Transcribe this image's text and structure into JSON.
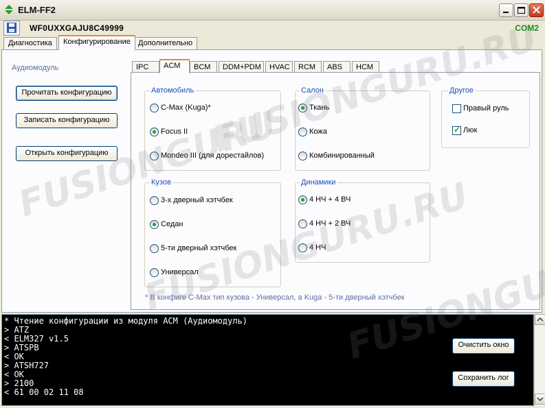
{
  "window": {
    "title": "ELM-FF2"
  },
  "header": {
    "vin": "WF0UXXGAJU8C49999",
    "port": "COM2"
  },
  "main_tabs": [
    {
      "label": "Диагностика",
      "active": false
    },
    {
      "label": "Конфигурирование",
      "active": true
    },
    {
      "label": "Дополнительно",
      "active": false
    }
  ],
  "sidebar": {
    "module_label": "Аудиомодуль",
    "read_button": "Прочитать конфигурацию",
    "write_button": "Записать конфигурацию",
    "open_button": "Открыть конфигурацию"
  },
  "sub_tabs": [
    {
      "label": "IPC",
      "active": false
    },
    {
      "label": "ACM",
      "active": true
    },
    {
      "label": "BCM",
      "active": false
    },
    {
      "label": "DDM+PDM",
      "active": false
    },
    {
      "label": "HVAC",
      "active": false
    },
    {
      "label": "RCM",
      "active": false
    },
    {
      "label": "ABS",
      "active": false
    },
    {
      "label": "HCM",
      "active": false
    }
  ],
  "groups": {
    "car": {
      "title": "Автомобиль",
      "options": [
        {
          "label": "C-Max (Kuga)*",
          "checked": false
        },
        {
          "label": "Focus II",
          "checked": true
        },
        {
          "label": "Mondeo III (для дорестайлов)",
          "checked": false
        }
      ]
    },
    "salon": {
      "title": "Салон",
      "options": [
        {
          "label": "Ткань",
          "checked": true
        },
        {
          "label": "Кожа",
          "checked": false
        },
        {
          "label": "Комбинированный",
          "checked": false
        }
      ]
    },
    "other": {
      "title": "Другое",
      "options": [
        {
          "label": "Правый руль",
          "checked": false
        },
        {
          "label": "Люк",
          "checked": true
        }
      ]
    },
    "body": {
      "title": "Кузов",
      "options": [
        {
          "label": "3-х дверный хэтчбек",
          "checked": false
        },
        {
          "label": "Седан",
          "checked": true
        },
        {
          "label": "5-ти дверный хэтчбек",
          "checked": false
        },
        {
          "label": "Универсал",
          "checked": false
        }
      ]
    },
    "speakers": {
      "title": "Динамики",
      "options": [
        {
          "label": "4 НЧ + 4 ВЧ",
          "checked": true
        },
        {
          "label": "4 НЧ + 2 ВЧ",
          "checked": false
        },
        {
          "label": "4 НЧ",
          "checked": false
        }
      ]
    }
  },
  "footnote": "* В конфиге C-Max тип кузова - Универсал, а Kuga - 5-ти дверный хэтчбек",
  "log": {
    "lines": [
      "* Чтение конфигурации из модуля ACM (Аудиомодуль)",
      "> ATZ",
      "< ELM327 v1.5",
      "> ATSPB",
      "< OK",
      "> ATSH727",
      "< OK",
      "> 2100",
      "< 61 00 02 11 08"
    ],
    "clear_button": "Очистить окно",
    "save_button": "Сохранить лог"
  },
  "colors": {
    "accent_tab": "#e68b2c",
    "group_title": "#1b4fb4",
    "port": "#1f8a20",
    "radio_on": "#21a121"
  }
}
